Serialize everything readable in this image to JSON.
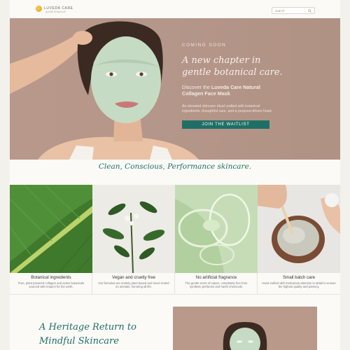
{
  "header": {
    "brand": "LUVEDA CARE",
    "brand_script": "gentle botanical",
    "search_placeholder": "search"
  },
  "hero": {
    "eyebrow": "COMING SOON",
    "headline_line1": "A new chapter in",
    "headline_line2": "gentle botanical care.",
    "desc_prefix": "Discover the ",
    "desc_bold": "Luveda Care Natural Collagen Face Mask",
    "desc2": "An elevated skincare ritual crafted with botanical ingredients, thoughtful care, and a purpose-driven heart.",
    "cta_label": "JOIN THE WAITLIST"
  },
  "tagline": "Clean, Conscious, Performance skincare.",
  "features": [
    {
      "title": "Botanical ingredients",
      "text": "Pure, plant powered collagen and active botanicals sourced with respect for the earth."
    },
    {
      "title": "Vegan and cruelty free",
      "text": "Our formulas are entirely plant based and never tested on animals, honoring all life."
    },
    {
      "title": "No artificial fragrance",
      "text": "The gentle scent of nature, completely free from synthetic perfumes and harsh chemicals."
    },
    {
      "title": "Small batch care",
      "text": "Hand crafted with meticulous attention to detail to ensure the highest quality and potency."
    }
  ],
  "heritage": {
    "line1": "A Heritage Return to",
    "line2": "Mindful Skincare"
  },
  "colors": {
    "accent": "#1f6f66",
    "hero_bg": "#b9998a",
    "page_bg": "#fbfaf7"
  }
}
